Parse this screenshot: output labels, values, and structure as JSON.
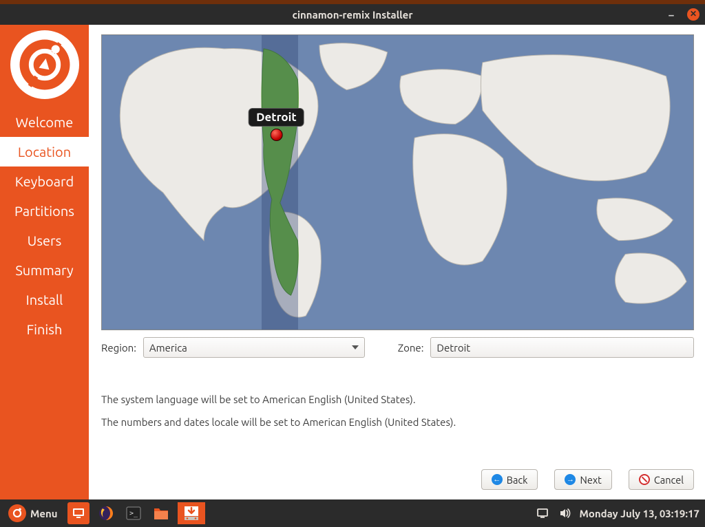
{
  "window": {
    "title": "cinnamon-remix Installer"
  },
  "sidebar": {
    "steps": [
      {
        "label": "Welcome"
      },
      {
        "label": "Location"
      },
      {
        "label": "Keyboard"
      },
      {
        "label": "Partitions"
      },
      {
        "label": "Users"
      },
      {
        "label": "Summary"
      },
      {
        "label": "Install"
      },
      {
        "label": "Finish"
      }
    ],
    "active_index": 1
  },
  "map": {
    "pin_label": "Detroit"
  },
  "region": {
    "label": "Region:",
    "value": "America"
  },
  "zone": {
    "label": "Zone:",
    "value": "Detroit"
  },
  "locale": {
    "lang_line": "The system language will be set to American English (United States).",
    "num_line": "The numbers and dates locale will be set to American English (United States)."
  },
  "buttons": {
    "back": "Back",
    "next": "Next",
    "cancel": "Cancel"
  },
  "panel": {
    "menu": "Menu",
    "clock": "Monday July 13, 03:19:17"
  }
}
